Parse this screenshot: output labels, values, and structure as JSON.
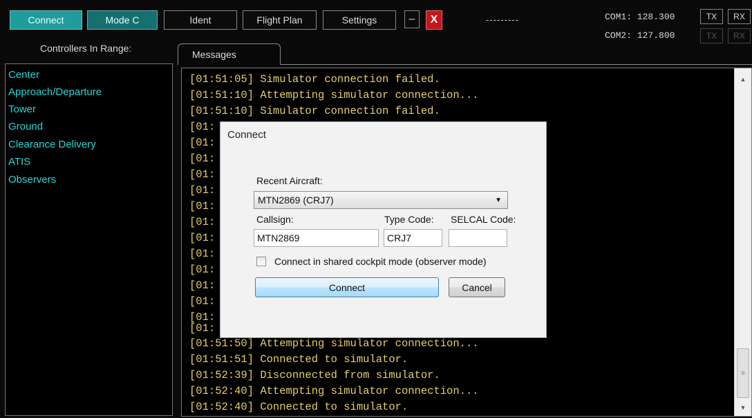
{
  "toolbar": {
    "connect": "Connect",
    "mode_c": "Mode C",
    "ident": "Ident",
    "flight_plan": "Flight Plan",
    "settings": "Settings",
    "minimize": "–",
    "close": "X",
    "status": "---------"
  },
  "radios": {
    "com1_label": "COM1: 128.300",
    "com2_label": "COM2: 127.800",
    "tx": "TX",
    "rx": "RX"
  },
  "controllers": {
    "title": "Controllers In Range:",
    "items": [
      "Center",
      "Approach/Departure",
      "Tower",
      "Ground",
      "Clearance Delivery",
      "ATIS",
      "Observers"
    ]
  },
  "messages": {
    "tab": "Messages",
    "lines": [
      "[01:51:05] Simulator connection failed.",
      "[01:51:10] Attempting simulator connection...",
      "[01:51:10] Simulator connection failed.",
      "[01:",
      "[01:",
      "[01:",
      "[01:",
      "[01:",
      "[01:",
      "[01:",
      "[01:",
      "[01:",
      "[01:",
      "[01:",
      "[01:",
      "[01:",
      "[01:",
      "[01:51:50] Attempting simulator connection...",
      "[01:51:51] Connected to simulator.",
      "[01:52:39] Disconnected from simulator.",
      "[01:52:40] Attempting simulator connection...",
      "[01:52:40] Connected to simulator."
    ]
  },
  "dialog": {
    "title": "Connect",
    "recent_label": "Recent Aircraft:",
    "recent_value": "MTN2869 (CRJ7)",
    "callsign_label": "Callsign:",
    "callsign_value": "MTN2869",
    "type_label": "Type Code:",
    "type_value": "CRJ7",
    "selcal_label": "SELCAL Code:",
    "selcal_value": "",
    "shared_label": "Connect in shared cockpit mode (observer mode)",
    "connect_btn": "Connect",
    "cancel_btn": "Cancel"
  }
}
